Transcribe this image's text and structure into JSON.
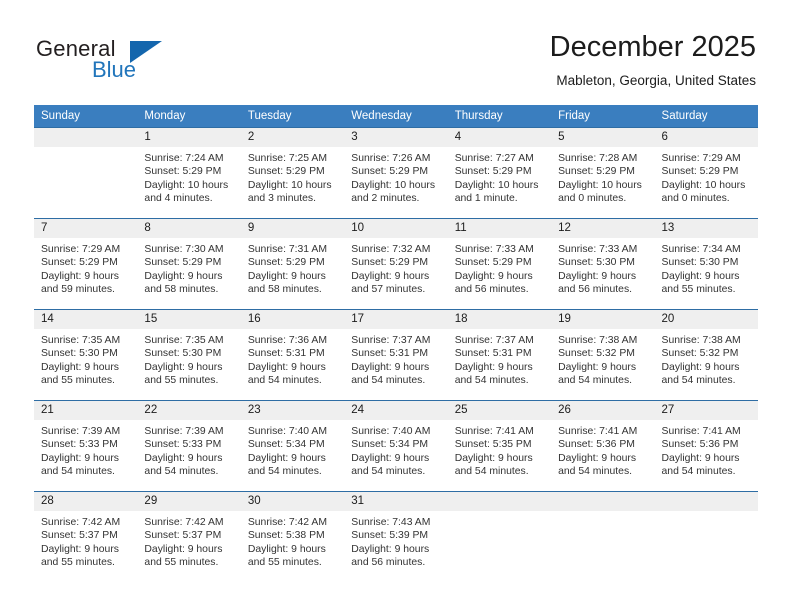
{
  "brand": {
    "general": "General",
    "blue": "Blue",
    "triangle_color": "#1466ad",
    "blue_color": "#2175bb"
  },
  "header": {
    "title": "December 2025",
    "subtitle": "Mableton, Georgia, United States"
  },
  "theme": {
    "header_row_bg": "#3a7ebf",
    "row_border": "#2e6da4",
    "daynum_bg": "#efefef"
  },
  "weekday_headers": [
    "Sunday",
    "Monday",
    "Tuesday",
    "Wednesday",
    "Thursday",
    "Friday",
    "Saturday"
  ],
  "weeks": [
    [
      {
        "day": "",
        "sunrise": "",
        "sunset": "",
        "daylight_line1": "",
        "daylight_line2": "",
        "empty": true
      },
      {
        "day": "1",
        "sunrise": "Sunrise: 7:24 AM",
        "sunset": "Sunset: 5:29 PM",
        "daylight_line1": "Daylight: 10 hours",
        "daylight_line2": "and 4 minutes."
      },
      {
        "day": "2",
        "sunrise": "Sunrise: 7:25 AM",
        "sunset": "Sunset: 5:29 PM",
        "daylight_line1": "Daylight: 10 hours",
        "daylight_line2": "and 3 minutes."
      },
      {
        "day": "3",
        "sunrise": "Sunrise: 7:26 AM",
        "sunset": "Sunset: 5:29 PM",
        "daylight_line1": "Daylight: 10 hours",
        "daylight_line2": "and 2 minutes."
      },
      {
        "day": "4",
        "sunrise": "Sunrise: 7:27 AM",
        "sunset": "Sunset: 5:29 PM",
        "daylight_line1": "Daylight: 10 hours",
        "daylight_line2": "and 1 minute."
      },
      {
        "day": "5",
        "sunrise": "Sunrise: 7:28 AM",
        "sunset": "Sunset: 5:29 PM",
        "daylight_line1": "Daylight: 10 hours",
        "daylight_line2": "and 0 minutes."
      },
      {
        "day": "6",
        "sunrise": "Sunrise: 7:29 AM",
        "sunset": "Sunset: 5:29 PM",
        "daylight_line1": "Daylight: 10 hours",
        "daylight_line2": "and 0 minutes."
      }
    ],
    [
      {
        "day": "7",
        "sunrise": "Sunrise: 7:29 AM",
        "sunset": "Sunset: 5:29 PM",
        "daylight_line1": "Daylight: 9 hours",
        "daylight_line2": "and 59 minutes."
      },
      {
        "day": "8",
        "sunrise": "Sunrise: 7:30 AM",
        "sunset": "Sunset: 5:29 PM",
        "daylight_line1": "Daylight: 9 hours",
        "daylight_line2": "and 58 minutes."
      },
      {
        "day": "9",
        "sunrise": "Sunrise: 7:31 AM",
        "sunset": "Sunset: 5:29 PM",
        "daylight_line1": "Daylight: 9 hours",
        "daylight_line2": "and 58 minutes."
      },
      {
        "day": "10",
        "sunrise": "Sunrise: 7:32 AM",
        "sunset": "Sunset: 5:29 PM",
        "daylight_line1": "Daylight: 9 hours",
        "daylight_line2": "and 57 minutes."
      },
      {
        "day": "11",
        "sunrise": "Sunrise: 7:33 AM",
        "sunset": "Sunset: 5:29 PM",
        "daylight_line1": "Daylight: 9 hours",
        "daylight_line2": "and 56 minutes."
      },
      {
        "day": "12",
        "sunrise": "Sunrise: 7:33 AM",
        "sunset": "Sunset: 5:30 PM",
        "daylight_line1": "Daylight: 9 hours",
        "daylight_line2": "and 56 minutes."
      },
      {
        "day": "13",
        "sunrise": "Sunrise: 7:34 AM",
        "sunset": "Sunset: 5:30 PM",
        "daylight_line1": "Daylight: 9 hours",
        "daylight_line2": "and 55 minutes."
      }
    ],
    [
      {
        "day": "14",
        "sunrise": "Sunrise: 7:35 AM",
        "sunset": "Sunset: 5:30 PM",
        "daylight_line1": "Daylight: 9 hours",
        "daylight_line2": "and 55 minutes."
      },
      {
        "day": "15",
        "sunrise": "Sunrise: 7:35 AM",
        "sunset": "Sunset: 5:30 PM",
        "daylight_line1": "Daylight: 9 hours",
        "daylight_line2": "and 55 minutes."
      },
      {
        "day": "16",
        "sunrise": "Sunrise: 7:36 AM",
        "sunset": "Sunset: 5:31 PM",
        "daylight_line1": "Daylight: 9 hours",
        "daylight_line2": "and 54 minutes."
      },
      {
        "day": "17",
        "sunrise": "Sunrise: 7:37 AM",
        "sunset": "Sunset: 5:31 PM",
        "daylight_line1": "Daylight: 9 hours",
        "daylight_line2": "and 54 minutes."
      },
      {
        "day": "18",
        "sunrise": "Sunrise: 7:37 AM",
        "sunset": "Sunset: 5:31 PM",
        "daylight_line1": "Daylight: 9 hours",
        "daylight_line2": "and 54 minutes."
      },
      {
        "day": "19",
        "sunrise": "Sunrise: 7:38 AM",
        "sunset": "Sunset: 5:32 PM",
        "daylight_line1": "Daylight: 9 hours",
        "daylight_line2": "and 54 minutes."
      },
      {
        "day": "20",
        "sunrise": "Sunrise: 7:38 AM",
        "sunset": "Sunset: 5:32 PM",
        "daylight_line1": "Daylight: 9 hours",
        "daylight_line2": "and 54 minutes."
      }
    ],
    [
      {
        "day": "21",
        "sunrise": "Sunrise: 7:39 AM",
        "sunset": "Sunset: 5:33 PM",
        "daylight_line1": "Daylight: 9 hours",
        "daylight_line2": "and 54 minutes."
      },
      {
        "day": "22",
        "sunrise": "Sunrise: 7:39 AM",
        "sunset": "Sunset: 5:33 PM",
        "daylight_line1": "Daylight: 9 hours",
        "daylight_line2": "and 54 minutes."
      },
      {
        "day": "23",
        "sunrise": "Sunrise: 7:40 AM",
        "sunset": "Sunset: 5:34 PM",
        "daylight_line1": "Daylight: 9 hours",
        "daylight_line2": "and 54 minutes."
      },
      {
        "day": "24",
        "sunrise": "Sunrise: 7:40 AM",
        "sunset": "Sunset: 5:34 PM",
        "daylight_line1": "Daylight: 9 hours",
        "daylight_line2": "and 54 minutes."
      },
      {
        "day": "25",
        "sunrise": "Sunrise: 7:41 AM",
        "sunset": "Sunset: 5:35 PM",
        "daylight_line1": "Daylight: 9 hours",
        "daylight_line2": "and 54 minutes."
      },
      {
        "day": "26",
        "sunrise": "Sunrise: 7:41 AM",
        "sunset": "Sunset: 5:36 PM",
        "daylight_line1": "Daylight: 9 hours",
        "daylight_line2": "and 54 minutes."
      },
      {
        "day": "27",
        "sunrise": "Sunrise: 7:41 AM",
        "sunset": "Sunset: 5:36 PM",
        "daylight_line1": "Daylight: 9 hours",
        "daylight_line2": "and 54 minutes."
      }
    ],
    [
      {
        "day": "28",
        "sunrise": "Sunrise: 7:42 AM",
        "sunset": "Sunset: 5:37 PM",
        "daylight_line1": "Daylight: 9 hours",
        "daylight_line2": "and 55 minutes."
      },
      {
        "day": "29",
        "sunrise": "Sunrise: 7:42 AM",
        "sunset": "Sunset: 5:37 PM",
        "daylight_line1": "Daylight: 9 hours",
        "daylight_line2": "and 55 minutes."
      },
      {
        "day": "30",
        "sunrise": "Sunrise: 7:42 AM",
        "sunset": "Sunset: 5:38 PM",
        "daylight_line1": "Daylight: 9 hours",
        "daylight_line2": "and 55 minutes."
      },
      {
        "day": "31",
        "sunrise": "Sunrise: 7:43 AM",
        "sunset": "Sunset: 5:39 PM",
        "daylight_line1": "Daylight: 9 hours",
        "daylight_line2": "and 56 minutes."
      },
      {
        "day": "",
        "sunrise": "",
        "sunset": "",
        "daylight_line1": "",
        "daylight_line2": "",
        "empty": true
      },
      {
        "day": "",
        "sunrise": "",
        "sunset": "",
        "daylight_line1": "",
        "daylight_line2": "",
        "empty": true
      },
      {
        "day": "",
        "sunrise": "",
        "sunset": "",
        "daylight_line1": "",
        "daylight_line2": "",
        "empty": true
      }
    ]
  ]
}
